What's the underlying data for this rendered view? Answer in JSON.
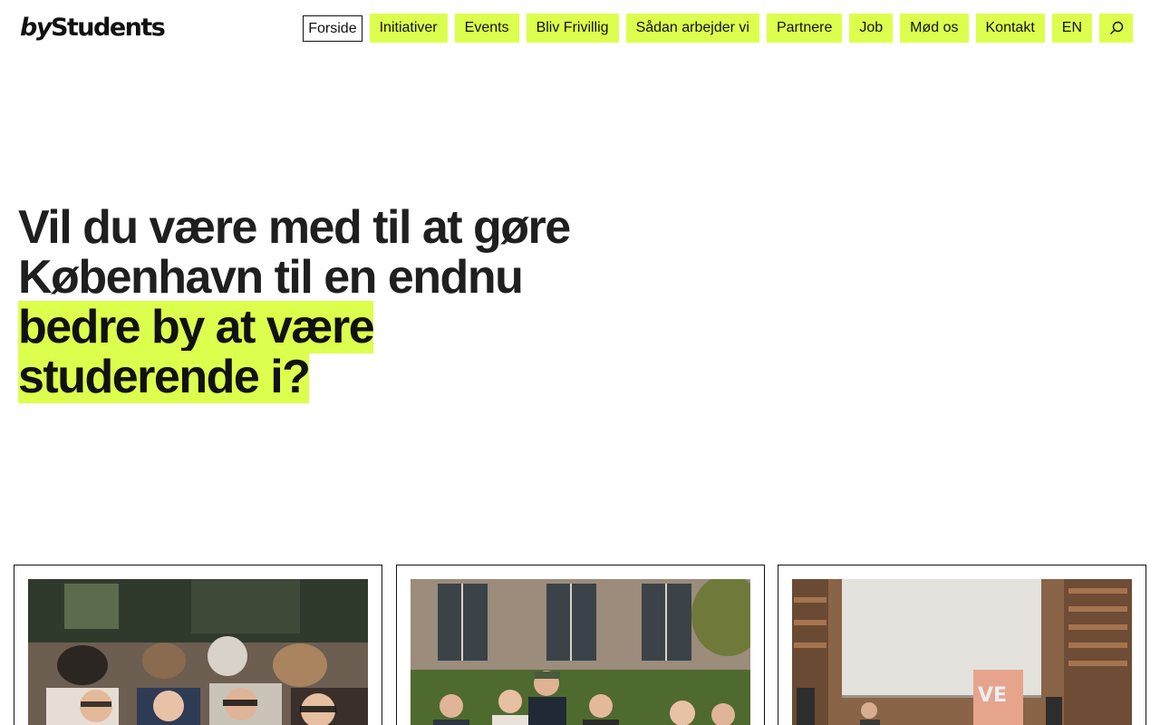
{
  "site": {
    "logo_prefix": "by",
    "logo_name": "Students"
  },
  "nav": {
    "items": [
      {
        "label": "Forside",
        "active": true
      },
      {
        "label": "Initiativer"
      },
      {
        "label": "Events"
      },
      {
        "label": "Bliv Frivillig"
      },
      {
        "label": "Sådan arbejder vi"
      },
      {
        "label": "Partnere"
      },
      {
        "label": "Job"
      },
      {
        "label": "Mød os"
      },
      {
        "label": "Kontakt"
      },
      {
        "label": "EN"
      }
    ],
    "search_icon": "search-icon"
  },
  "hero": {
    "line1": "Vil du være med til at gøre",
    "line2": "København til en endnu",
    "highlight1": "bedre by at være",
    "highlight2": "studerende i?"
  },
  "colors": {
    "accent": "#dcff4d",
    "text": "#1f1f1f",
    "border": "#111111"
  },
  "cards": [
    {
      "image": "crowd-of-students-at-outdoor-bar"
    },
    {
      "image": "students-in-front-of-brick-building"
    },
    {
      "image": "speaker-in-library-hall"
    }
  ]
}
